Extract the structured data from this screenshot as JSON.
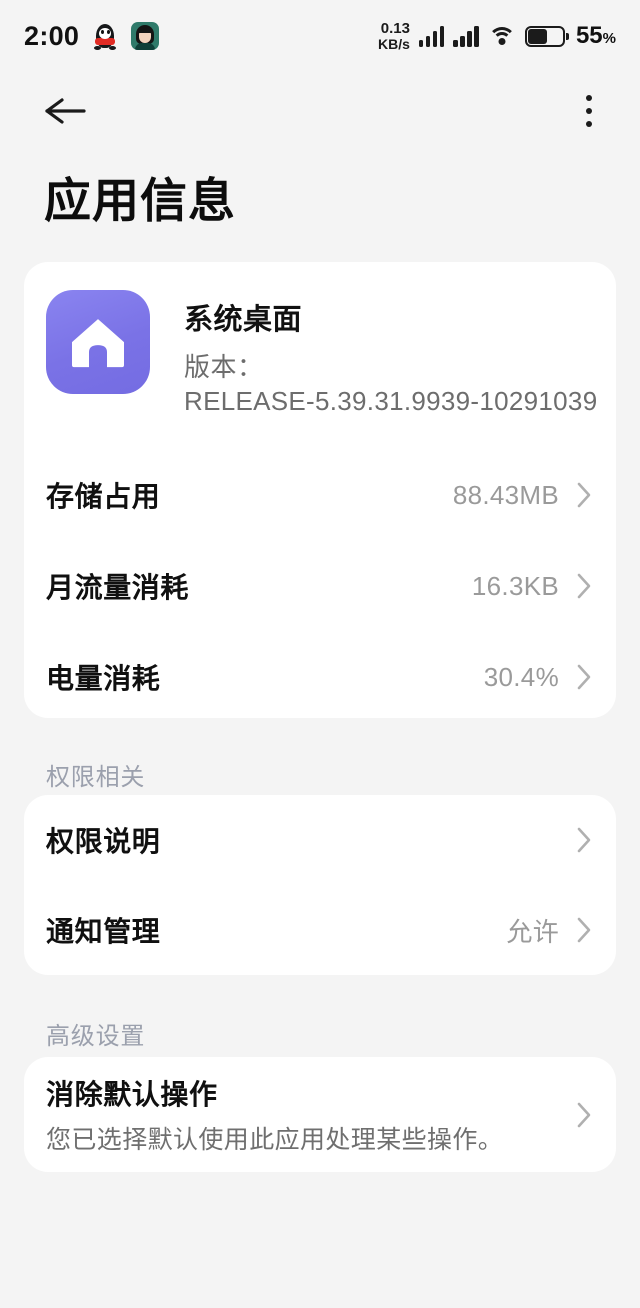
{
  "status_bar": {
    "time": "2:00",
    "tray_icons": [
      "qq-icon",
      "contacts-app-icon"
    ],
    "net_speed_value": "0.13",
    "net_speed_unit": "KB/s",
    "signal_icons": [
      "signal-bars-sim1",
      "signal-bars-sim2"
    ],
    "wifi_icon": "wifi-icon",
    "battery_icon": "battery-icon",
    "battery_percent": "55",
    "battery_percent_symbol": "%"
  },
  "nav": {
    "back_icon": "back-arrow-icon",
    "menu_icon": "more-options-icon"
  },
  "header": {
    "title": "应用信息"
  },
  "app": {
    "icon": "system-launcher-icon",
    "icon_color": "#7a72e6",
    "name": "系统桌面",
    "version_label": "版本：",
    "version_value": "RELEASE-5.39.31.9939-10291039"
  },
  "usage_rows": [
    {
      "title": "存储占用",
      "value": "88.43MB",
      "chevron": "chevron-right-icon"
    },
    {
      "title": "月流量消耗",
      "value": "16.3KB",
      "chevron": "chevron-right-icon"
    },
    {
      "title": "电量消耗",
      "value": "30.4%",
      "chevron": "chevron-right-icon"
    }
  ],
  "permission_section": {
    "label": "权限相关",
    "rows": [
      {
        "title": "权限说明",
        "value": "",
        "chevron": "chevron-right-icon"
      },
      {
        "title": "通知管理",
        "value": "允许",
        "chevron": "chevron-right-icon"
      }
    ]
  },
  "advanced_section": {
    "label": "高级设置",
    "row": {
      "title": "消除默认操作",
      "subtitle": "您已选择默认使用此应用处理某些操作。",
      "chevron": "chevron-right-icon"
    }
  }
}
